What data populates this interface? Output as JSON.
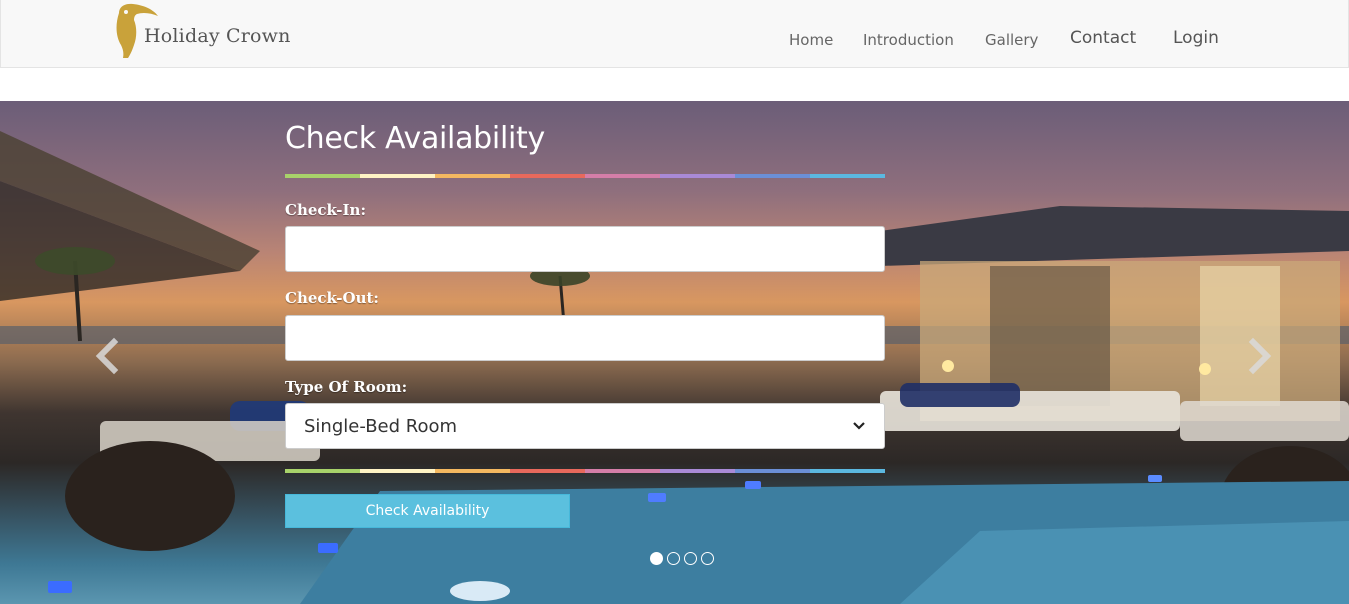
{
  "brand": {
    "name": "Holiday Crown",
    "logo_icon": "toucan-logo-icon",
    "color": "#c9a23a"
  },
  "nav": {
    "items": [
      {
        "label": "Home"
      },
      {
        "label": "Introduction"
      },
      {
        "label": "Gallery"
      },
      {
        "label": "Contact"
      },
      {
        "label": "Login"
      }
    ]
  },
  "carousel": {
    "prev_icon": "chevron-left-icon",
    "next_icon": "chevron-right-icon",
    "slide_count": 4,
    "active_slide": 1
  },
  "form": {
    "title": "Check Availability",
    "checkin": {
      "label": "Check-In:",
      "value": "",
      "placeholder": ""
    },
    "checkout": {
      "label": "Check-Out:",
      "value": "",
      "placeholder": ""
    },
    "room_type": {
      "label": "Type Of Room:",
      "selected": "Single-Bed Room",
      "icon": "chevron-down-icon"
    },
    "submit_label": "Check Availability",
    "accent_colors": [
      "#a8d26a",
      "#fff3c4",
      "#f4b860",
      "#e8695c",
      "#d47ea8",
      "#a98ad6",
      "#6b8fd6",
      "#5bb8e0"
    ],
    "button_color": "#5bc0de"
  }
}
